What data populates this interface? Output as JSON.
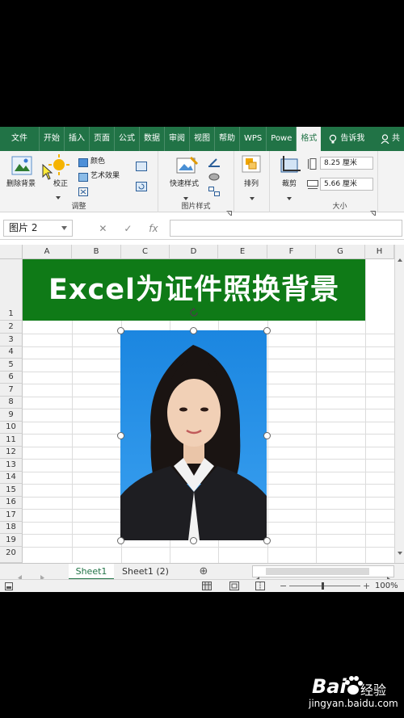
{
  "tabs": [
    "文件",
    "开始",
    "插入",
    "页面",
    "公式",
    "数据",
    "审阅",
    "视图",
    "帮助",
    "WPS",
    "Powe",
    "格式"
  ],
  "tell_me": "告诉我",
  "user_label": "共",
  "ribbon": {
    "remove_bg": "删除背景",
    "corrections": "校正",
    "color": "颜色",
    "artistic": "艺术效果",
    "adjust_group": "调整",
    "quick_styles": "快速样式",
    "styles_group": "图片样式",
    "arrange": "排列",
    "crop": "裁剪",
    "height": "8.25 厘米",
    "width": "5.66 厘米",
    "size_group": "大小"
  },
  "formula_bar": {
    "name_box": "图片 2",
    "cancel": "✕",
    "enter": "✓",
    "fx": "fx"
  },
  "columns": [
    "A",
    "B",
    "C",
    "D",
    "E",
    "F",
    "G",
    "H"
  ],
  "rows": [
    "1",
    "2",
    "3",
    "4",
    "5",
    "6",
    "7",
    "8",
    "9",
    "10",
    "11",
    "12",
    "13",
    "14",
    "15",
    "16",
    "17",
    "18",
    "19",
    "20"
  ],
  "banner_text": "Excel为证件照换背景",
  "sheets": [
    "Sheet1",
    "Sheet1 (2)"
  ],
  "add_sheet": "⊕",
  "zoom": "100%",
  "watermark": {
    "brand": "Bai",
    "brand_suffix": "经验",
    "site": "jingyan.baidu.com"
  },
  "colors": {
    "ribbon_green": "#217346",
    "banner_green": "#0f7a17",
    "photo_blue": "#1e8ee6"
  }
}
